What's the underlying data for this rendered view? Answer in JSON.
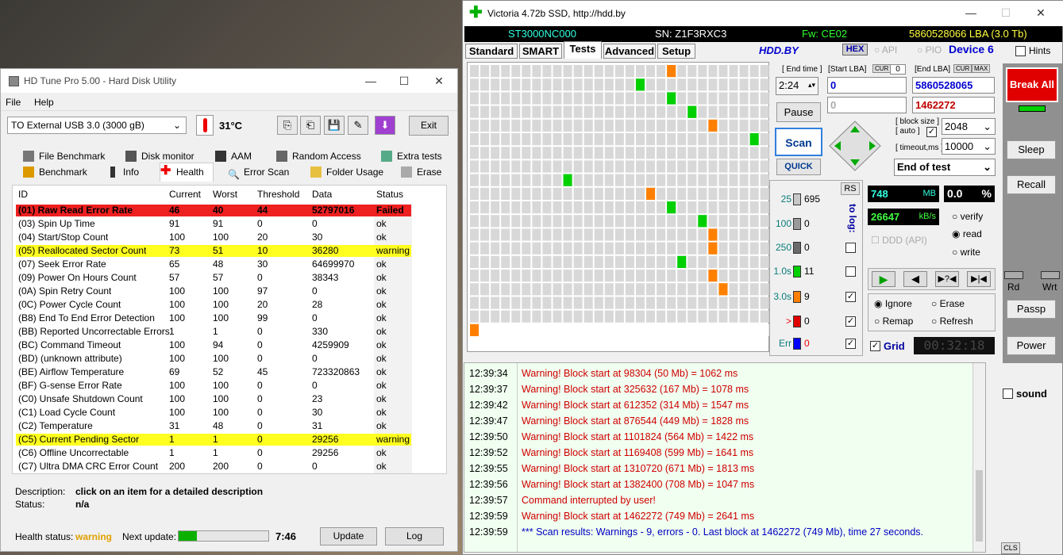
{
  "hdtune": {
    "title": "HD Tune Pro 5.00 - Hard Disk Utility",
    "menu": [
      "File",
      "Help"
    ],
    "drive": "TO External USB 3.0     (3000 gB)",
    "temperature": "31°C",
    "exit_label": "Exit",
    "tabs_row1": [
      "File Benchmark",
      "Disk monitor",
      "AAM",
      "Random Access",
      "Extra tests"
    ],
    "tabs_row2": [
      "Benchmark",
      "Info",
      "Health",
      "Error Scan",
      "Folder Usage",
      "Erase"
    ],
    "headers": [
      "ID",
      "Current",
      "Worst",
      "Threshold",
      "Data",
      "Status"
    ],
    "rows": [
      {
        "id": "(01) Raw Read Error Rate",
        "cur": "46",
        "worst": "40",
        "thr": "44",
        "data": "52797016",
        "status": "Failed",
        "hl": "red"
      },
      {
        "id": "(03) Spin Up Time",
        "cur": "91",
        "worst": "91",
        "thr": "0",
        "data": "0",
        "status": "ok",
        "hl": ""
      },
      {
        "id": "(04) Start/Stop Count",
        "cur": "100",
        "worst": "100",
        "thr": "20",
        "data": "30",
        "status": "ok",
        "hl": ""
      },
      {
        "id": "(05) Reallocated Sector Count",
        "cur": "73",
        "worst": "51",
        "thr": "10",
        "data": "36280",
        "status": "warning",
        "hl": "yellow"
      },
      {
        "id": "(07) Seek Error Rate",
        "cur": "65",
        "worst": "48",
        "thr": "30",
        "data": "64699970",
        "status": "ok",
        "hl": ""
      },
      {
        "id": "(09) Power On Hours Count",
        "cur": "57",
        "worst": "57",
        "thr": "0",
        "data": "38343",
        "status": "ok",
        "hl": ""
      },
      {
        "id": "(0A) Spin Retry Count",
        "cur": "100",
        "worst": "100",
        "thr": "97",
        "data": "0",
        "status": "ok",
        "hl": ""
      },
      {
        "id": "(0C) Power Cycle Count",
        "cur": "100",
        "worst": "100",
        "thr": "20",
        "data": "28",
        "status": "ok",
        "hl": ""
      },
      {
        "id": "(B8) End To End Error Detection",
        "cur": "100",
        "worst": "100",
        "thr": "99",
        "data": "0",
        "status": "ok",
        "hl": ""
      },
      {
        "id": "(BB) Reported Uncorrectable Errors",
        "cur": "1",
        "worst": "1",
        "thr": "0",
        "data": "330",
        "status": "ok",
        "hl": ""
      },
      {
        "id": "(BC) Command Timeout",
        "cur": "100",
        "worst": "94",
        "thr": "0",
        "data": "4259909",
        "status": "ok",
        "hl": ""
      },
      {
        "id": "(BD) (unknown attribute)",
        "cur": "100",
        "worst": "100",
        "thr": "0",
        "data": "0",
        "status": "ok",
        "hl": ""
      },
      {
        "id": "(BE) Airflow Temperature",
        "cur": "69",
        "worst": "52",
        "thr": "45",
        "data": "723320863",
        "status": "ok",
        "hl": ""
      },
      {
        "id": "(BF) G-sense Error Rate",
        "cur": "100",
        "worst": "100",
        "thr": "0",
        "data": "0",
        "status": "ok",
        "hl": ""
      },
      {
        "id": "(C0) Unsafe Shutdown Count",
        "cur": "100",
        "worst": "100",
        "thr": "0",
        "data": "23",
        "status": "ok",
        "hl": ""
      },
      {
        "id": "(C1) Load Cycle Count",
        "cur": "100",
        "worst": "100",
        "thr": "0",
        "data": "30",
        "status": "ok",
        "hl": ""
      },
      {
        "id": "(C2) Temperature",
        "cur": "31",
        "worst": "48",
        "thr": "0",
        "data": "31",
        "status": "ok",
        "hl": ""
      },
      {
        "id": "(C5) Current Pending Sector",
        "cur": "1",
        "worst": "1",
        "thr": "0",
        "data": "29256",
        "status": "warning",
        "hl": "yellow"
      },
      {
        "id": "(C6) Offline Uncorrectable",
        "cur": "1",
        "worst": "1",
        "thr": "0",
        "data": "29256",
        "status": "ok",
        "hl": ""
      },
      {
        "id": "(C7) Ultra DMA CRC Error Count",
        "cur": "200",
        "worst": "200",
        "thr": "0",
        "data": "0",
        "status": "ok",
        "hl": ""
      }
    ],
    "desc_label": "Description:",
    "desc_value": "click on an item for a detailed description",
    "status_label": "Status:",
    "status_value": "n/a",
    "health_label": "Health status:",
    "health_value": "warning",
    "next_update_label": "Next update:",
    "next_update_progress": 0.2,
    "next_update_time": "7:46",
    "update_label": "Update",
    "log_label": "Log"
  },
  "victoria": {
    "title": "Victoria 4.72b SSD, http://hdd.by",
    "model": "ST3000NC000",
    "sn": "SN: Z1F3RXC3",
    "fw": "Fw: CE02",
    "lba": "5860528066 LBA (3.0 Tb)",
    "tabs": [
      "Standard",
      "SMART",
      "Tests",
      "Advanced",
      "Setup"
    ],
    "hddby": "HDD.BY",
    "hex": "HEX",
    "api": "API",
    "pio": "PIO",
    "device": "Device 6",
    "hints": "Hints",
    "end_time_label": "[ End time ]",
    "end_time": "2:24",
    "start_lba_label": "[Start LBA]",
    "cur": "CUR",
    "start_lba": "0",
    "start_lba_zero": "0",
    "end_lba_label": "[End LBA]",
    "max": "MAX",
    "end_lba": "5860528065",
    "cur_lba": "0",
    "cur_lba_red": "1462272",
    "pause": "Pause",
    "scan": "Scan",
    "quick": "QUICK",
    "block_size_label": "[ block size ]",
    "auto_label": "[ auto ]",
    "block_size": "2048",
    "timeout_label": "[ timeout,ms ]",
    "timeout": "10000",
    "end_of_test": "End of test",
    "rs": "RS",
    "to_log": "to log:",
    "legend": [
      {
        "label": "25",
        "count": "695",
        "color": "#c8c8c8"
      },
      {
        "label": "100",
        "count": "0",
        "color": "#9a9a9a"
      },
      {
        "label": "250",
        "count": "0",
        "color": "#6a6a6a"
      },
      {
        "label": "1.0s",
        "count": "11",
        "color": "#00d000"
      },
      {
        "label": "3.0s",
        "count": "9",
        "color": "#ff8000"
      },
      {
        "label": ">",
        "count": "0",
        "color": "#e00000"
      },
      {
        "label": "Err",
        "count": "0",
        "color": "#0000ff"
      }
    ],
    "mb_value": "748",
    "mb_unit": "MB",
    "pct_value": "0.0",
    "pct_unit": "%",
    "kbs_value": "26647",
    "kbs_unit": "kB/s",
    "verify": "verify",
    "read": "read",
    "write": "write",
    "ddd": "DDD (API)",
    "ignore": "Ignore",
    "erase": "Erase",
    "remap": "Remap",
    "refresh": "Refresh",
    "grid_label": "Grid",
    "clock": "00:32:18",
    "break_all": "Break All",
    "sleep": "Sleep",
    "recall": "Recall",
    "rd": "Rd",
    "wrt": "Wrt",
    "passp": "Passp",
    "power": "Power",
    "sound": "sound",
    "cls": "CLS",
    "log": [
      {
        "t": "12:39:34",
        "m": "Warning! Block start at 98304 (50 Mb)  = 1062 ms",
        "c": "#d00000"
      },
      {
        "t": "12:39:37",
        "m": "Warning! Block start at 325632 (167 Mb)  = 1078 ms",
        "c": "#d00000"
      },
      {
        "t": "12:39:42",
        "m": "Warning! Block start at 612352 (314 Mb)  = 1547 ms",
        "c": "#d00000"
      },
      {
        "t": "12:39:47",
        "m": "Warning! Block start at 876544 (449 Mb)  = 1828 ms",
        "c": "#d00000"
      },
      {
        "t": "12:39:50",
        "m": "Warning! Block start at 1101824 (564 Mb)  = 1422 ms",
        "c": "#d00000"
      },
      {
        "t": "12:39:52",
        "m": "Warning! Block start at 1169408 (599 Mb)  = 1641 ms",
        "c": "#d00000"
      },
      {
        "t": "12:39:55",
        "m": "Warning! Block start at 1310720 (671 Mb)  = 1813 ms",
        "c": "#d00000"
      },
      {
        "t": "12:39:56",
        "m": "Warning! Block start at 1382400 (708 Mb)  = 1047 ms",
        "c": "#d00000"
      },
      {
        "t": "12:39:57",
        "m": "Command interrupted by user!",
        "c": "#d00000"
      },
      {
        "t": "12:39:59",
        "m": "Warning! Block start at 1462272 (749 Mb)  = 2641 ms",
        "c": "#d00000"
      },
      {
        "t": "12:39:59",
        "m": "*** Scan results: Warnings - 9, errors - 0. Last block at 1462272 (749 Mb), time 27 seconds.",
        "c": "#0000c0"
      }
    ]
  }
}
